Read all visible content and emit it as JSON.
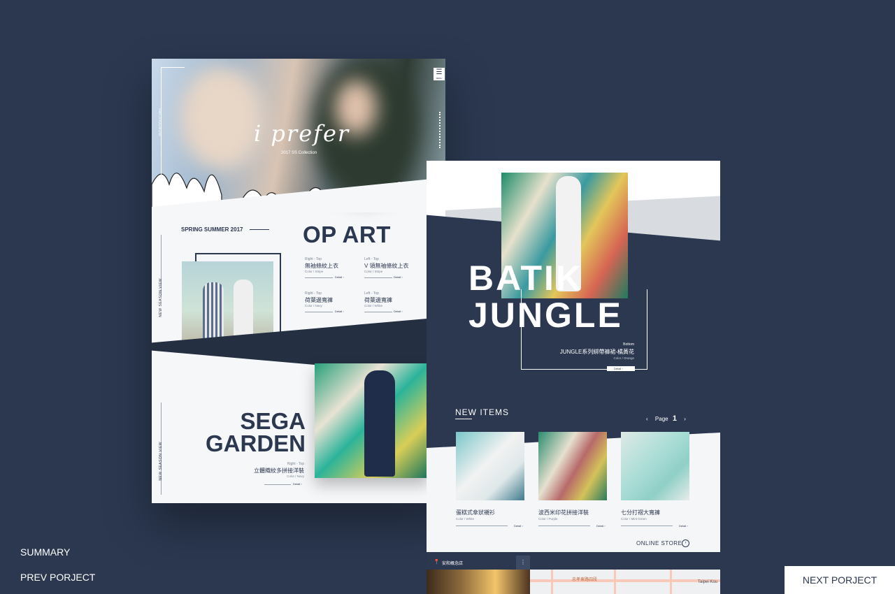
{
  "left": {
    "hero": {
      "logo": "i prefer",
      "sub": "2017 SS Collection",
      "menu_icon": "☰",
      "menu_label": "MENU",
      "side_label": "INTRODUCING"
    },
    "season_label": "SPRING SUMMER 2017",
    "opart_title": "OP ART",
    "side_label_2": "NEW SEASON VIEW",
    "side_label_3": "NEW SEASON VIEW",
    "products": [
      {
        "cat": "Right - Top",
        "name": "無袖條紋上衣",
        "color": "Color / Stripe",
        "detail": "Detail ›"
      },
      {
        "cat": "Left - Top",
        "name": "V 領無袖條紋上衣",
        "color": "Color / Stripe",
        "detail": "Detail ›"
      },
      {
        "cat": "Right - Top",
        "name": "荷葉邊寬褲",
        "color": "Color / Navy",
        "detail": "Detail ›"
      },
      {
        "cat": "Left - Top",
        "name": "荷葉邊寬褲",
        "color": "Color / White",
        "detail": "Detail ›"
      }
    ],
    "sega": {
      "title1": "SEGA",
      "title2": "GARDEN",
      "cat": "Right - Top",
      "name": "立體織紋多拼接洋裝",
      "color": "Color / Navy",
      "detail": "Detail ›"
    }
  },
  "right": {
    "batik1": "BATIK",
    "batik2": "JUNGLE",
    "feature": {
      "cat": "Bottom",
      "name": "JUNGLE系列綁帶褲裙-橘黃花",
      "color": "Color / Orange",
      "detail": "Detail ›"
    },
    "new_items": "NEW ITEMS",
    "pager": {
      "prev": "‹",
      "label": "Page",
      "num": "1",
      "next": "›"
    },
    "items": [
      {
        "name": "蛋糕式傘狀襯衫",
        "color": "Color / White",
        "detail": "Detail ›"
      },
      {
        "name": "波西米印花拼接洋裝",
        "color": "Color / Purple",
        "detail": "Detail ›"
      },
      {
        "name": "七分打褶大寬褲",
        "color": "Color / Mint Green",
        "detail": "Detail ›"
      }
    ],
    "online_store": "ONLINE STORE",
    "store_icon": "›",
    "map": {
      "pin": "📍",
      "title": "安和概念店",
      "more": "⋮",
      "street": "忠孝東路四段",
      "city": "Taipei Kou"
    }
  },
  "nav": {
    "summary": "SUMMARY",
    "prev": "PREV PORJECT",
    "next": "NEXT PORJECT"
  },
  "colors": {
    "background": "#2b3850",
    "navy": "#2b3850",
    "white": "#ffffff"
  }
}
